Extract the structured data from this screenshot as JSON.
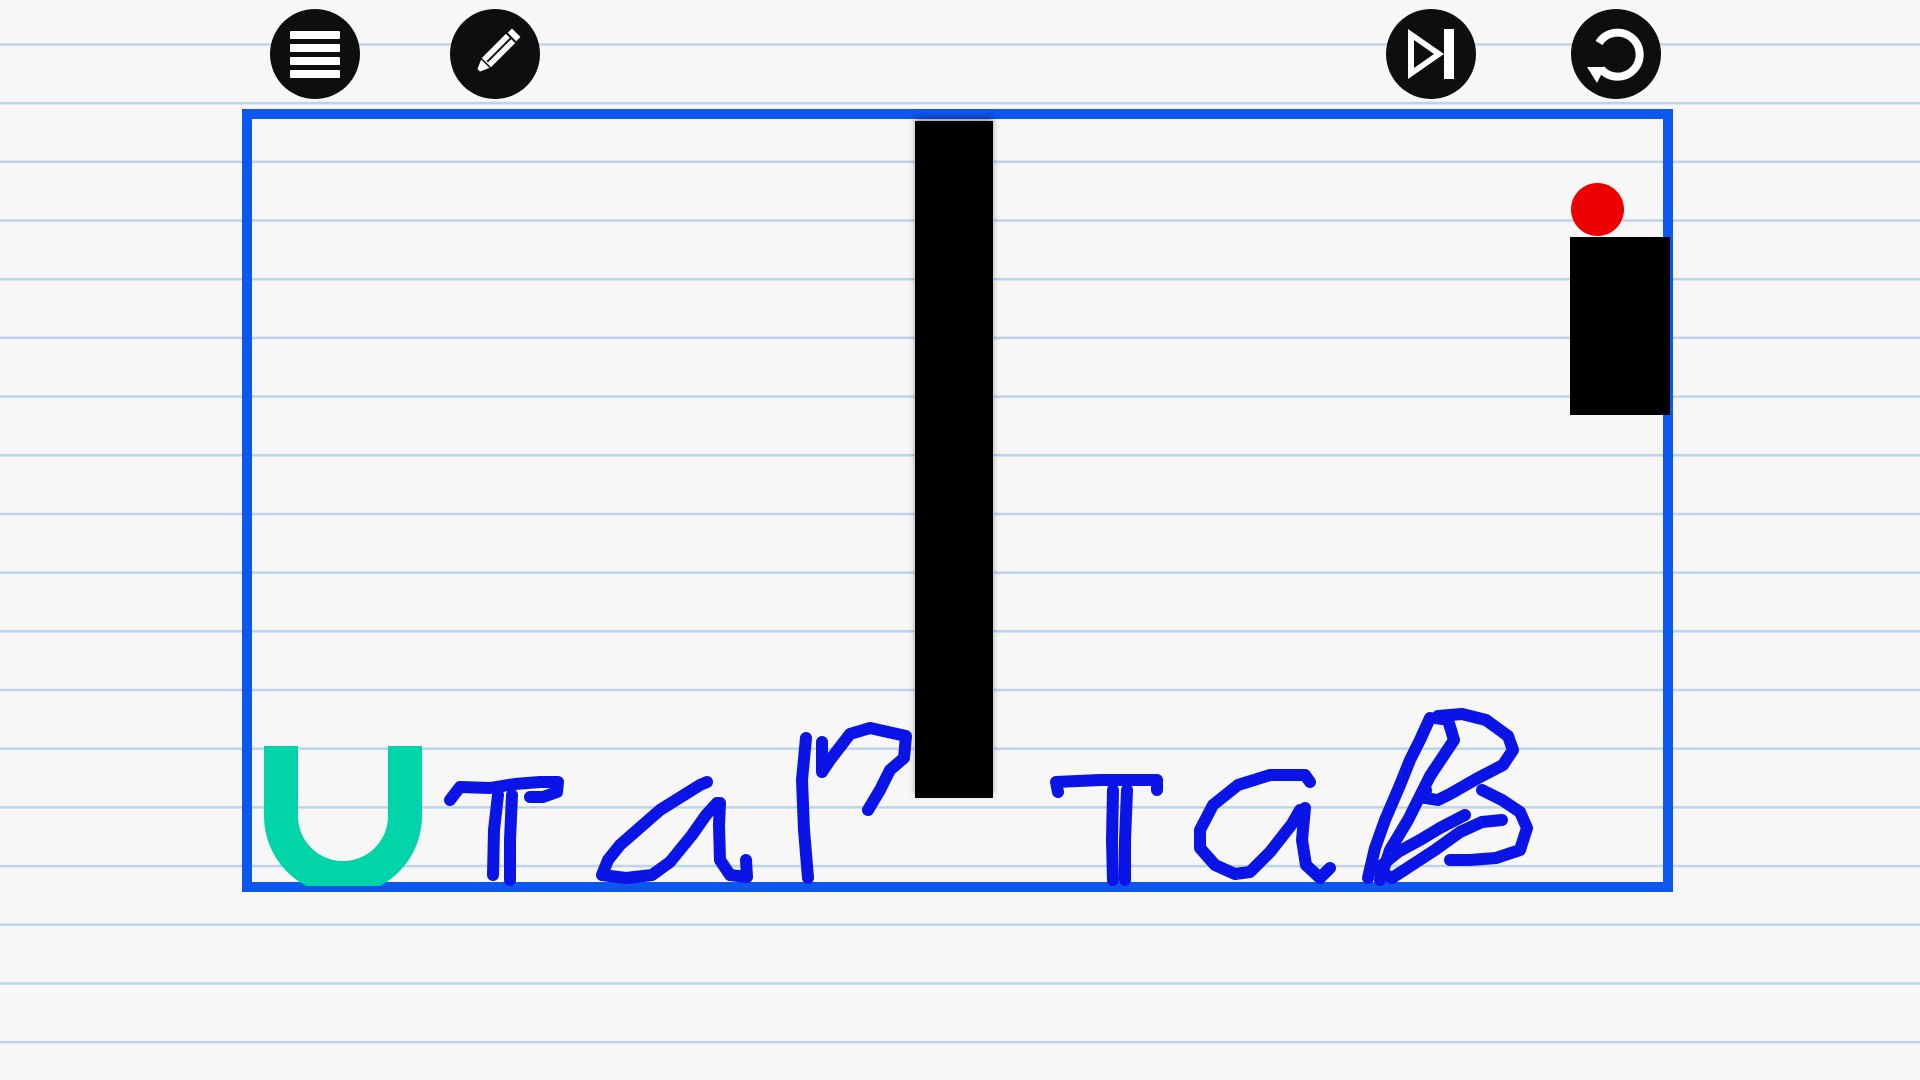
{
  "toolbar": {
    "menu_icon": "hamburger-menu-icon",
    "pencil_icon": "pencil-icon",
    "skip_icon": "skip-forward-icon",
    "restart_icon": "restart-icon"
  },
  "level": {
    "drawn_text": "Utap taB",
    "colors": {
      "frame": "#0b57f0",
      "ink": "#0a14e6",
      "cup": "#00d4a8",
      "ball": "#ee0000",
      "walls": "#000000",
      "button": "#0e0e0e"
    }
  }
}
